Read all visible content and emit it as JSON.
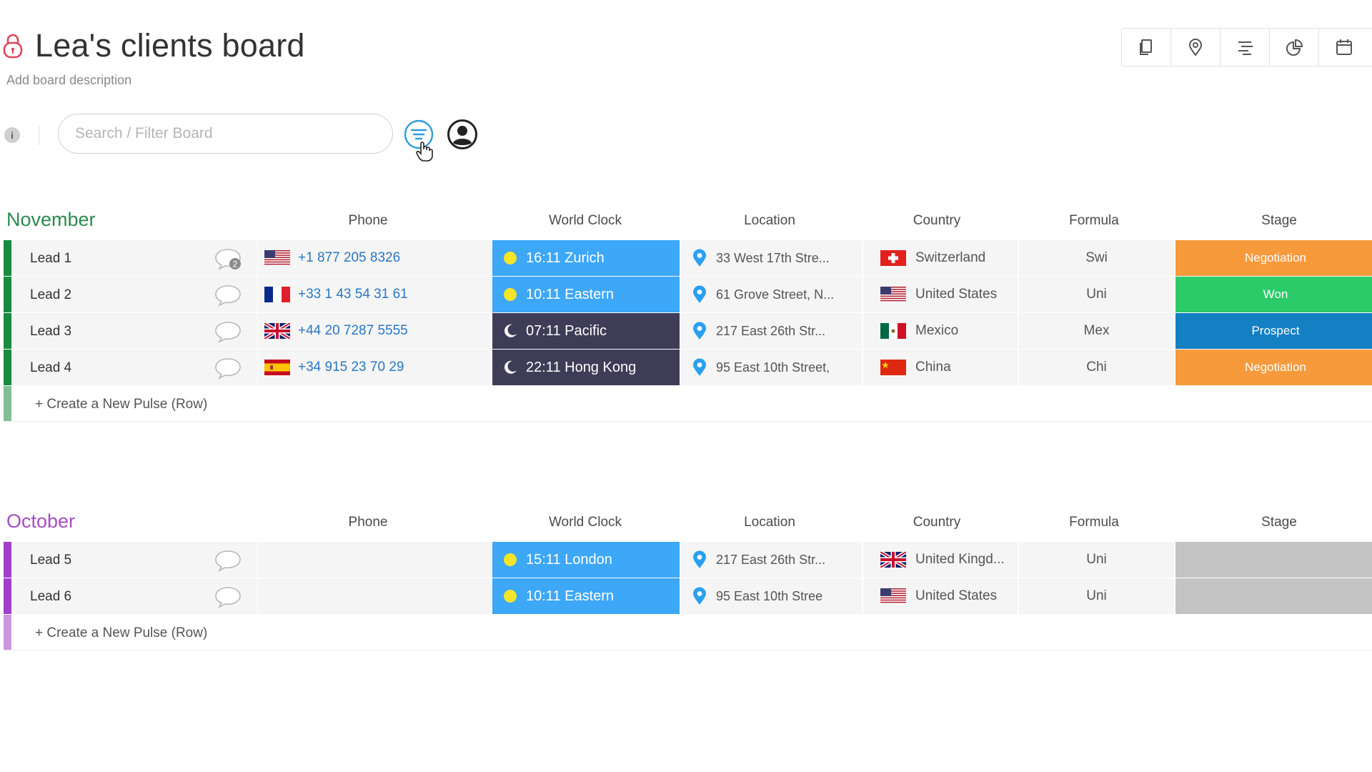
{
  "board": {
    "title": "Lea's clients board",
    "description": "Add board description"
  },
  "toolbar": {
    "info_label": "i",
    "search_placeholder": "Search / Filter Board"
  },
  "view_icons": [
    "pages-icon",
    "map-pin-icon",
    "timeline-icon",
    "chart-icon",
    "calendar-icon"
  ],
  "columns": [
    "Phone",
    "World Clock",
    "Location",
    "Country",
    "Formula",
    "Stage"
  ],
  "new_row_label": "+ Create a New Pulse (Row)",
  "colors": {
    "november": "#2b8a4f",
    "november_bar": "#1a8b3e",
    "october": "#a54dc5",
    "october_bar": "#a23fc9",
    "clock_day": "#3da7f8",
    "clock_night": "#3f3c57",
    "negotiation": "#f79a3c",
    "won": "#2bcb6a",
    "prospect": "#1380c4",
    "empty_stage": "#c4c4c4",
    "lock": "#e2445c",
    "filter": "#2d9cdb"
  },
  "groups": [
    {
      "name": "November",
      "rows": [
        {
          "name": "Lead 1",
          "updates": "2",
          "phone_flag": "us",
          "phone": "+1 877 205 8326",
          "clock_mode": "day",
          "clock": "16:11 Zurich",
          "location": "33 West 17th Stre...",
          "country_flag": "ch",
          "country": "Switzerland",
          "formula": "Swi",
          "stage": "Negotiation",
          "stage_color": "#f79a3c"
        },
        {
          "name": "Lead 2",
          "updates": "",
          "phone_flag": "fr",
          "phone": "+33 1 43 54 31 61",
          "clock_mode": "day",
          "clock": "10:11 Eastern",
          "location": "61 Grove Street, N...",
          "country_flag": "us",
          "country": "United States",
          "formula": "Uni",
          "stage": "Won",
          "stage_color": "#2bcb6a"
        },
        {
          "name": "Lead 3",
          "updates": "",
          "phone_flag": "uk",
          "phone": "+44 20 7287 5555",
          "clock_mode": "night",
          "clock": "07:11 Pacific",
          "location": "217 East 26th Str...",
          "country_flag": "mx",
          "country": "Mexico",
          "formula": "Mex",
          "stage": "Prospect",
          "stage_color": "#1380c4"
        },
        {
          "name": "Lead 4",
          "updates": "",
          "phone_flag": "es",
          "phone": "+34 915 23 70 29",
          "clock_mode": "night",
          "clock": "22:11 Hong Kong",
          "location": "95 East 10th Street,",
          "country_flag": "cn",
          "country": "China",
          "formula": "Chi",
          "stage": "Negotiation",
          "stage_color": "#f79a3c"
        }
      ]
    },
    {
      "name": "October",
      "rows": [
        {
          "name": "Lead 5",
          "updates": "",
          "phone_flag": "",
          "phone": "",
          "clock_mode": "day",
          "clock": "15:11 London",
          "location": "217 East 26th Str...",
          "country_flag": "uk",
          "country": "United Kingd...",
          "formula": "Uni",
          "stage": "",
          "stage_color": "#c4c4c4"
        },
        {
          "name": "Lead 6",
          "updates": "",
          "phone_flag": "",
          "phone": "",
          "clock_mode": "day",
          "clock": "10:11 Eastern",
          "location": "95 East 10th Stree",
          "country_flag": "us",
          "country": "United States",
          "formula": "Uni",
          "stage": "",
          "stage_color": "#c4c4c4"
        }
      ]
    }
  ]
}
